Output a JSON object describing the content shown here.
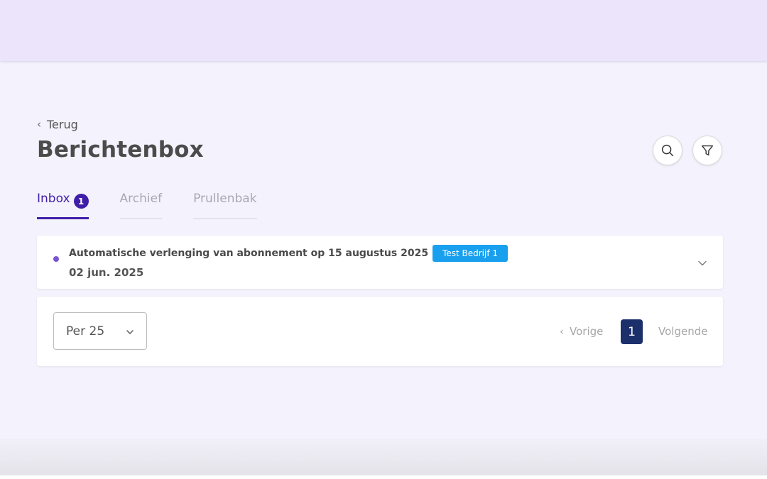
{
  "header": {
    "background_color": "#ebe4fb"
  },
  "nav": {
    "back_label": "Terug"
  },
  "page": {
    "title": "Berichtenbox"
  },
  "toolbar": {
    "search_icon": "search-icon",
    "filter_icon": "filter-icon"
  },
  "tabs": [
    {
      "label": "Inbox",
      "badge": "1",
      "active": true
    },
    {
      "label": "Archief",
      "active": false
    },
    {
      "label": "Prullenbak",
      "active": false
    }
  ],
  "messages": [
    {
      "subject": "Automatische verlenging van abonnement op 15 augustus 2025",
      "tag": "Test Bedrijf 1",
      "date": "02 jun. 2025",
      "unread": true
    }
  ],
  "pagination": {
    "per_page_label": "Per 25",
    "prev_label": "Vorige",
    "current_page": "1",
    "next_label": "Volgende"
  },
  "colors": {
    "accent": "#3f1fa8",
    "tag": "#18a0ef",
    "active_page": "#1b2f6b",
    "unread_dot": "#7a55cc"
  }
}
